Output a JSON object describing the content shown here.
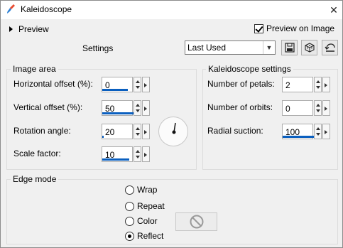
{
  "window": {
    "title": "Kaleidoscope",
    "close_icon": "close-icon",
    "app_icon": "paint-brush-icon"
  },
  "toolbar": {
    "preview_label": "Preview",
    "preview_on_image": {
      "label": "Preview on Image",
      "checked": true
    },
    "settings_label": "Settings",
    "preset_value": "Last Used",
    "buttons": [
      "save-preset-icon",
      "randomize-icon",
      "reset-icon"
    ]
  },
  "image_area": {
    "title": "Image area",
    "fields": [
      {
        "label": "Horizontal offset (%):",
        "value": "0"
      },
      {
        "label": "Vertical offset (%):",
        "value": "50"
      },
      {
        "label": "Rotation angle:",
        "value": "20"
      },
      {
        "label": "Scale factor:",
        "value": "10"
      }
    ]
  },
  "kaleidoscope_settings": {
    "title": "Kaleidoscope settings",
    "fields": [
      {
        "label": "Number of petals:",
        "value": "2"
      },
      {
        "label": "Number of orbits:",
        "value": "0"
      },
      {
        "label": "Radial suction:",
        "value": "100"
      }
    ]
  },
  "edge_mode": {
    "title": "Edge mode",
    "options": [
      "Wrap",
      "Repeat",
      "Color",
      "Reflect"
    ],
    "selected": "Reflect",
    "color_icon": "no-color-icon"
  },
  "colors": {
    "accent": "#0a5fbf"
  }
}
